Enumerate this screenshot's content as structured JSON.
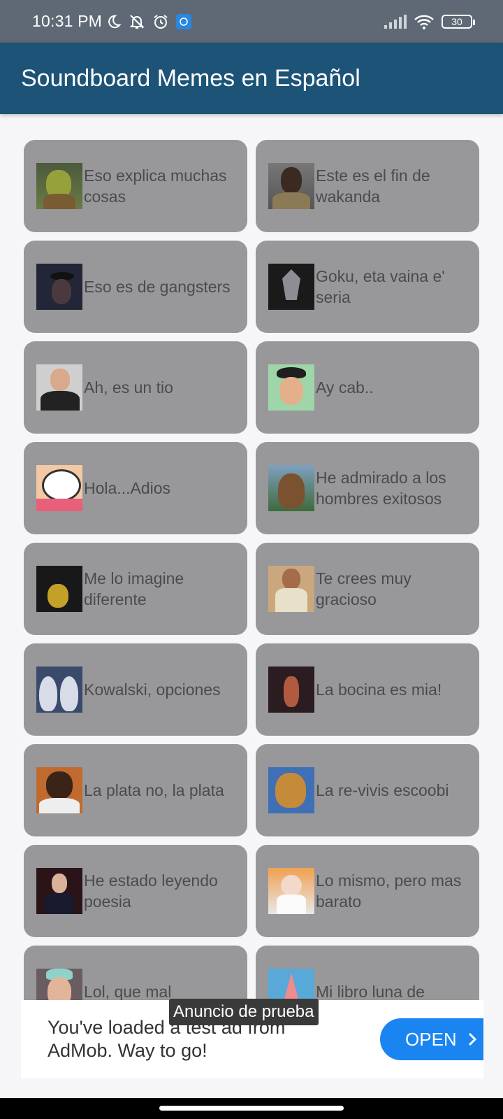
{
  "status_bar": {
    "time": "10:31 PM",
    "battery": "30",
    "icons": [
      "moon-icon",
      "bell-off-icon",
      "alarm-icon",
      "app-notification-icon",
      "signal-icon",
      "wifi-icon",
      "battery-icon"
    ]
  },
  "app_bar": {
    "title": "Soundboard Memes en Español",
    "color": "#1d5377"
  },
  "sounds": [
    {
      "label": "Eso explica muchas cosas"
    },
    {
      "label": "Este es el fin de wakanda"
    },
    {
      "label": "Eso es de gangsters"
    },
    {
      "label": "Goku, eta vaina e' seria"
    },
    {
      "label": "Ah, es un tio"
    },
    {
      "label": "Ay cab.."
    },
    {
      "label": "Hola...Adios"
    },
    {
      "label": "He admirado a los hombres exitosos"
    },
    {
      "label": "Me lo imagine diferente"
    },
    {
      "label": "Te crees muy gracioso"
    },
    {
      "label": "Kowalski, opciones"
    },
    {
      "label": "La bocina es mia!"
    },
    {
      "label": "La plata no, la plata"
    },
    {
      "label": "La re-vivis escoobi"
    },
    {
      "label": "He estado leyendo poesia"
    },
    {
      "label": "Lo mismo, pero mas barato"
    },
    {
      "label": "Lol, que mal"
    },
    {
      "label": "Mi libro luna de"
    }
  ],
  "ad": {
    "text": "You've loaded a test ad from AdMob. Way to go!",
    "button_label": "OPEN",
    "toast": "Anuncio de prueba"
  }
}
